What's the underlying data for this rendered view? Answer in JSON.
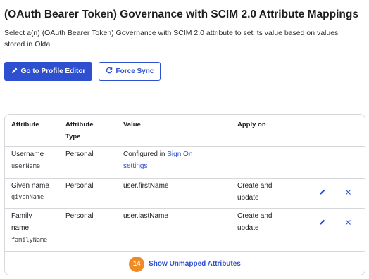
{
  "header": {
    "title": "(OAuth Bearer Token) Governance with SCIM 2.0 Attribute Mappings",
    "description": "Select a(n) (OAuth Bearer Token) Governance with SCIM 2.0 attribute to set its value based on values stored in Okta."
  },
  "actions": {
    "profile_editor_label": "Go to Profile Editor",
    "force_sync_label": "Force Sync"
  },
  "table": {
    "columns": {
      "attribute": "Attribute",
      "attribute_type_line1": "Attribute",
      "attribute_type_line2": "Type",
      "value": "Value",
      "apply_on": "Apply on"
    },
    "rows": [
      {
        "name": "Username",
        "name_line2": "",
        "var": "userName",
        "type": "Personal",
        "value_prefix": "Configured in ",
        "value_link1": "Sign On",
        "value_link2": "settings",
        "apply_line1": "",
        "apply_line2": ""
      },
      {
        "name": "Given name",
        "name_line2": "",
        "var": "givenName",
        "type": "Personal",
        "value": "user.firstName",
        "apply_line1": "Create and",
        "apply_line2": "update"
      },
      {
        "name": "Family",
        "name_line2": "name",
        "var": "familyName",
        "type": "Personal",
        "value": "user.lastName",
        "apply_line1": "Create and",
        "apply_line2": "update"
      }
    ]
  },
  "footer": {
    "badge": "14",
    "link_label": "Show Unmapped Attributes"
  },
  "icons": {
    "edit": "pencil-icon",
    "remove": "close-icon",
    "sync": "refresh-icon"
  },
  "colors": {
    "primary": "#2d4fd0",
    "badge": "#f08a24",
    "border": "#d7d7dc"
  }
}
